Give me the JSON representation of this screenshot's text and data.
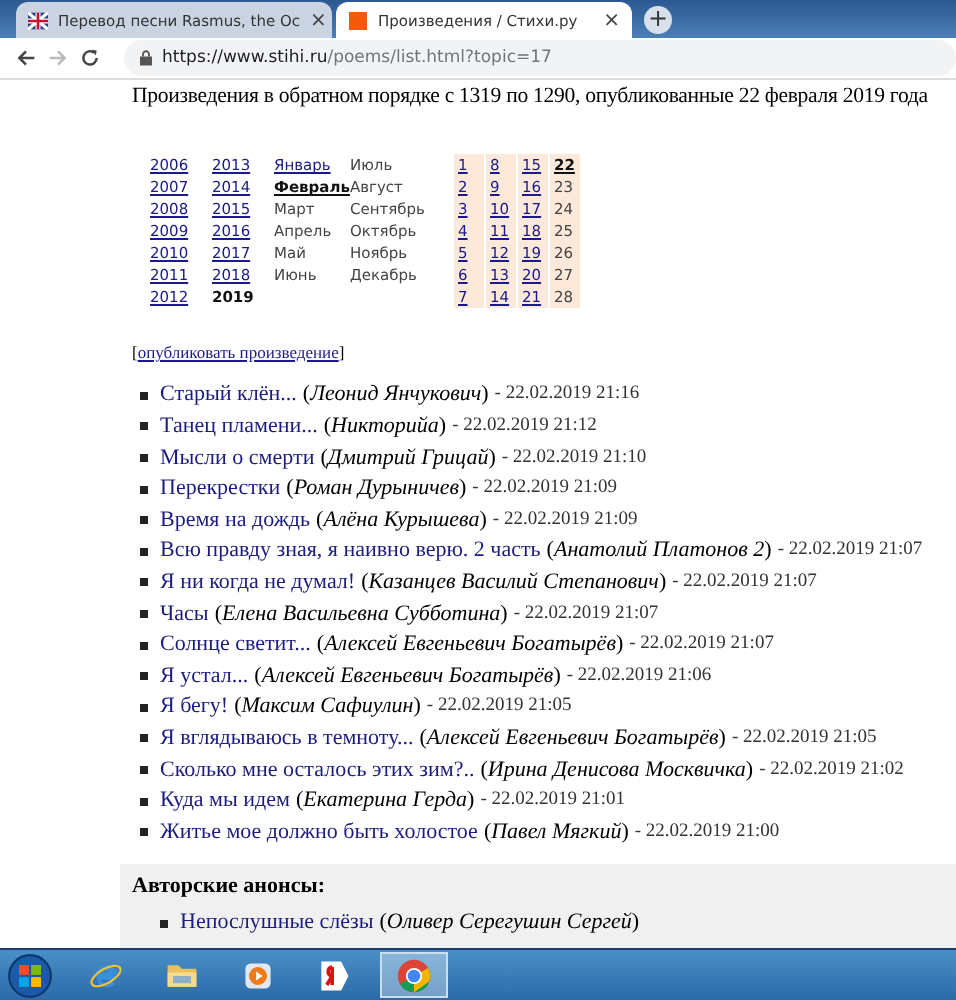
{
  "browser": {
    "tabs": [
      {
        "title": "Перевод песни Rasmus, the Oc",
        "selected": false,
        "close": "×"
      },
      {
        "title": "Произведения / Стихи.ру",
        "selected": true,
        "close": "×"
      }
    ],
    "new_tab": "+",
    "url": {
      "host": "https://www.stihi.ru",
      "path": "/poems/list.html?topic=17"
    }
  },
  "heading": "Произведения в обратном порядке с 1319 по 1290, опубликованные 22 февраля 2019 года",
  "calendar": {
    "years": [
      {
        "label": "2006",
        "selected": false
      },
      {
        "label": "2007",
        "selected": false
      },
      {
        "label": "2008",
        "selected": false
      },
      {
        "label": "2009",
        "selected": false
      },
      {
        "label": "2010",
        "selected": false
      },
      {
        "label": "2011",
        "selected": false
      },
      {
        "label": "2012",
        "selected": false
      },
      {
        "label": "2013",
        "selected": false
      },
      {
        "label": "2014",
        "selected": false
      },
      {
        "label": "2015",
        "selected": false
      },
      {
        "label": "2016",
        "selected": false
      },
      {
        "label": "2017",
        "selected": false
      },
      {
        "label": "2018",
        "selected": false
      },
      {
        "label": "2019",
        "selected": true
      }
    ],
    "months": [
      {
        "label": "Январь",
        "selected": false,
        "enabled": true
      },
      {
        "label": "Февраль",
        "selected": true,
        "enabled": true
      },
      {
        "label": "Март",
        "selected": false,
        "enabled": false
      },
      {
        "label": "Апрель",
        "selected": false,
        "enabled": false
      },
      {
        "label": "Май",
        "selected": false,
        "enabled": false
      },
      {
        "label": "Июнь",
        "selected": false,
        "enabled": false
      },
      {
        "label": "Июль",
        "selected": false,
        "enabled": false
      },
      {
        "label": "Август",
        "selected": false,
        "enabled": false
      },
      {
        "label": "Сентябрь",
        "selected": false,
        "enabled": false
      },
      {
        "label": "Октябрь",
        "selected": false,
        "enabled": false
      },
      {
        "label": "Ноябрь",
        "selected": false,
        "enabled": false
      },
      {
        "label": "Декабрь",
        "selected": false,
        "enabled": false
      }
    ],
    "days": [
      {
        "label": "1",
        "selected": false,
        "enabled": true
      },
      {
        "label": "2",
        "selected": false,
        "enabled": true
      },
      {
        "label": "3",
        "selected": false,
        "enabled": true
      },
      {
        "label": "4",
        "selected": false,
        "enabled": true
      },
      {
        "label": "5",
        "selected": false,
        "enabled": true
      },
      {
        "label": "6",
        "selected": false,
        "enabled": true
      },
      {
        "label": "7",
        "selected": false,
        "enabled": true
      },
      {
        "label": "8",
        "selected": false,
        "enabled": true
      },
      {
        "label": "9",
        "selected": false,
        "enabled": true
      },
      {
        "label": "10",
        "selected": false,
        "enabled": true
      },
      {
        "label": "11",
        "selected": false,
        "enabled": true
      },
      {
        "label": "12",
        "selected": false,
        "enabled": true
      },
      {
        "label": "13",
        "selected": false,
        "enabled": true
      },
      {
        "label": "14",
        "selected": false,
        "enabled": true
      },
      {
        "label": "15",
        "selected": false,
        "enabled": true
      },
      {
        "label": "16",
        "selected": false,
        "enabled": true
      },
      {
        "label": "17",
        "selected": false,
        "enabled": true
      },
      {
        "label": "18",
        "selected": false,
        "enabled": true
      },
      {
        "label": "19",
        "selected": false,
        "enabled": true
      },
      {
        "label": "20",
        "selected": false,
        "enabled": true
      },
      {
        "label": "21",
        "selected": false,
        "enabled": true
      },
      {
        "label": "22",
        "selected": true,
        "enabled": true
      },
      {
        "label": "23",
        "selected": false,
        "enabled": false
      },
      {
        "label": "24",
        "selected": false,
        "enabled": false
      },
      {
        "label": "25",
        "selected": false,
        "enabled": false
      },
      {
        "label": "26",
        "selected": false,
        "enabled": false
      },
      {
        "label": "27",
        "selected": false,
        "enabled": false
      },
      {
        "label": "28",
        "selected": false,
        "enabled": false
      }
    ]
  },
  "publish": {
    "open": "[",
    "link": "опубликовать произведение",
    "close": "]"
  },
  "poems": [
    {
      "title": "Старый клён...",
      "author": "(*Леонид Янчукович*)",
      "date": "- 22.02.2019 21:16"
    },
    {
      "title": "Танец пламени...",
      "author": "(*Никторийа*)",
      "date": "- 22.02.2019 21:12"
    },
    {
      "title": "Мысли о смерти",
      "author": "(*Дмитрий Грицай*)",
      "date": "- 22.02.2019 21:10"
    },
    {
      "title": "Перекрестки",
      "author": "(*Роман Дурыничев*)",
      "date": "- 22.02.2019 21:09"
    },
    {
      "title": "Время на дождь",
      "author": "(*Алёна Курышева*)",
      "date": "- 22.02.2019 21:09"
    },
    {
      "title": "Всю правду зная, я наивно верю. 2 часть",
      "author": "(*Анатолий Платонов 2*)",
      "date": "- 22.02.2019 21:07"
    },
    {
      "title": "Я ни когда не думал!",
      "author": "(*Казанцев Василий Степанович*)",
      "date": "- 22.02.2019 21:07"
    },
    {
      "title": "Часы",
      "author": "(*Елена Васильевна Субботина*)",
      "date": "- 22.02.2019 21:07"
    },
    {
      "title": "Солнце светит...",
      "author": "(*Алексей Евгеньевич Богатырёв*)",
      "date": "- 22.02.2019 21:07"
    },
    {
      "title": "Я устал...",
      "author": "(*Алексей Евгеньевич Богатырёв*)",
      "date": "- 22.02.2019 21:06"
    },
    {
      "title": "Я бегу!",
      "author": "(*Максим Сафиулин*)",
      "date": "- 22.02.2019 21:05"
    },
    {
      "title": "Я вглядываюсь в темноту...",
      "author": "(*Алексей Евгеньевич Богатырёв*)",
      "date": "- 22.02.2019 21:05"
    },
    {
      "title": "Сколько мне осталось этих зим?..",
      "author": "(*Ирина Денисова Москвичка*)",
      "date": "- 22.02.2019 21:02"
    },
    {
      "title": "Куда мы идем",
      "author": "(*Екатерина Герда*)",
      "date": "- 22.02.2019 21:01"
    },
    {
      "title": "Житье мое должно быть холостое",
      "author": "(*Павел Мягкий*)",
      "date": "- 22.02.2019 21:00"
    }
  ],
  "announcements": {
    "title": "Авторские анонсы:",
    "items": [
      {
        "title": "Непослушные слёзы",
        "author": "(*Оливер Серегушин Сергей*)"
      }
    ]
  },
  "taskbar": {
    "items": [
      {
        "kind": "browser-e",
        "selected": false
      },
      {
        "kind": "folder",
        "selected": false
      },
      {
        "kind": "media",
        "selected": false
      },
      {
        "kind": "ya",
        "selected": false
      },
      {
        "kind": "chrome",
        "selected": true
      }
    ]
  }
}
